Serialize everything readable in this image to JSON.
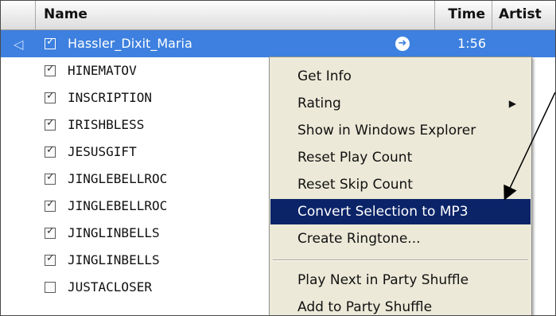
{
  "columns": {
    "name": "Name",
    "time": "Time",
    "artist": "Artist"
  },
  "rows": [
    {
      "name": "Hassler_Dixit_Maria",
      "time": "1:56",
      "checked": true,
      "selected": true
    },
    {
      "name": "HINEMATOV",
      "time": "",
      "checked": true,
      "selected": false
    },
    {
      "name": "INSCRIPTION",
      "time": "",
      "checked": true,
      "selected": false
    },
    {
      "name": "IRISHBLESS",
      "time": "",
      "checked": true,
      "selected": false
    },
    {
      "name": "JESUSGIFT",
      "time": "",
      "checked": true,
      "selected": false
    },
    {
      "name": "JINGLEBELLROC",
      "time": "",
      "checked": true,
      "selected": false
    },
    {
      "name": "JINGLEBELLROC",
      "time": "",
      "checked": true,
      "selected": false
    },
    {
      "name": "JINGLINBELLS",
      "time": "",
      "checked": true,
      "selected": false
    },
    {
      "name": "JINGLINBELLS",
      "time": "",
      "checked": true,
      "selected": false
    },
    {
      "name": "JUSTACLOSER",
      "time": "",
      "checked": false,
      "selected": false
    }
  ],
  "icons": {
    "playing": "speaker-icon",
    "goto": "arrow-right-circle-icon",
    "submenu": "triangle-right-icon",
    "annotation": "annotation-arrow"
  },
  "context_menu": {
    "items": [
      {
        "label": "Get Info"
      },
      {
        "label": "Rating",
        "submenu": true
      },
      {
        "label": "Show in Windows Explorer"
      },
      {
        "label": "Reset Play Count"
      },
      {
        "label": "Reset Skip Count"
      },
      {
        "label": "Convert Selection to MP3",
        "highlighted": true
      },
      {
        "label": "Create Ringtone..."
      },
      {
        "label": "Play Next in Party Shuffle"
      },
      {
        "label": "Add to Party Shuffle"
      }
    ]
  },
  "colors": {
    "selection": "#3d80df",
    "menu_highlight": "#0b2468",
    "menu_background": "#ece9d8"
  }
}
